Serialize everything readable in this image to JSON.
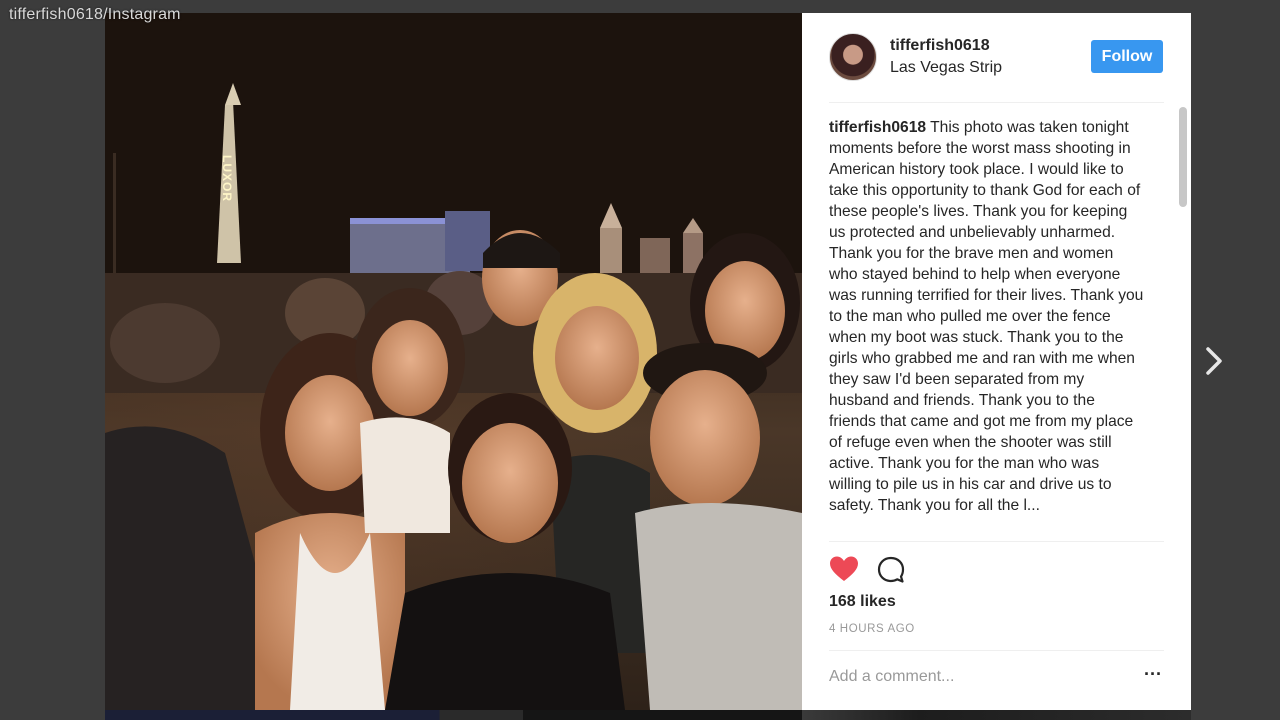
{
  "watermark": "tifferfish0618/Instagram",
  "post": {
    "username": "tifferfish0618",
    "location": "Las Vegas Strip",
    "follow_label": "Follow",
    "caption_user": "tifferfish0618",
    "caption_text": "This photo was taken tonight moments before the worst mass shooting in American history took place. I would like to take this opportunity to thank God for each of these people's lives. Thank you for keeping us protected and unbelievably unharmed. Thank you for the brave men and women who stayed behind to help when everyone was running terrified for their lives. Thank you to the man who pulled me over the fence when my boot was stuck. Thank you to the girls who grabbed me and ran with me when they saw I'd been separated from my husband and friends. Thank you to the friends that came and got me from my place of refuge even when the shooter was still active. Thank you for the man who was willing to pile us in his car and drive us to safety. Thank you for all the l...",
    "likes": "168 likes",
    "time": "4 HOURS AGO",
    "comment_placeholder": "Add a comment...",
    "more_label": "···"
  },
  "photo": {
    "sign_text": "LUXOR"
  },
  "colors": {
    "follow_bg": "#3897f0",
    "heart": "#ed4956",
    "backdrop": "#3c3c3c"
  },
  "icons": {
    "heart": "heart-icon",
    "comment": "comment-icon",
    "next": "chevron-right-icon",
    "more": "more-options-icon"
  }
}
